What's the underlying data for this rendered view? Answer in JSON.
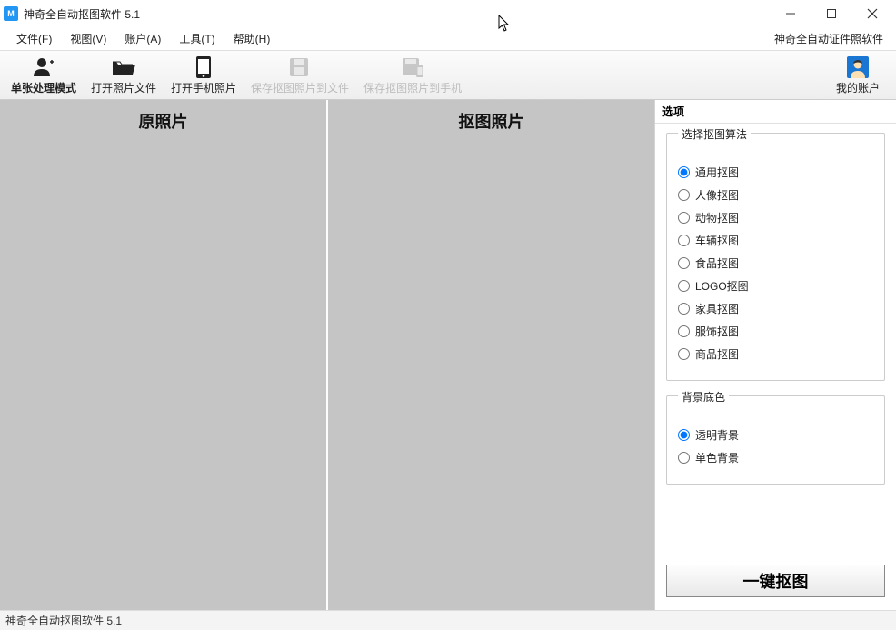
{
  "window": {
    "title": "神奇全自动抠图软件 5.1",
    "app_icon_text": "M"
  },
  "menubar": {
    "items": [
      "文件(F)",
      "视图(V)",
      "账户(A)",
      "工具(T)",
      "帮助(H)"
    ],
    "right_label": "神奇全自动证件照软件"
  },
  "toolbar": {
    "single_mode": "单张处理模式",
    "open_file": "打开照片文件",
    "open_phone": "打开手机照片",
    "save_file": "保存抠图照片到文件",
    "save_phone": "保存抠图照片到手机",
    "account": "我的账户"
  },
  "canvas": {
    "original": "原照片",
    "result": "抠图照片"
  },
  "options": {
    "header": "选项",
    "algorithm_legend": "选择抠图算法",
    "algorithms": [
      "通用抠图",
      "人像抠图",
      "动物抠图",
      "车辆抠图",
      "食品抠图",
      "LOGO抠图",
      "家具抠图",
      "服饰抠图",
      "商品抠图"
    ],
    "algorithm_selected": 0,
    "background_legend": "背景底色",
    "backgrounds": [
      "透明背景",
      "单色背景"
    ],
    "background_selected": 0,
    "primary_button": "一键抠图"
  },
  "statusbar": {
    "text": "神奇全自动抠图软件 5.1"
  }
}
